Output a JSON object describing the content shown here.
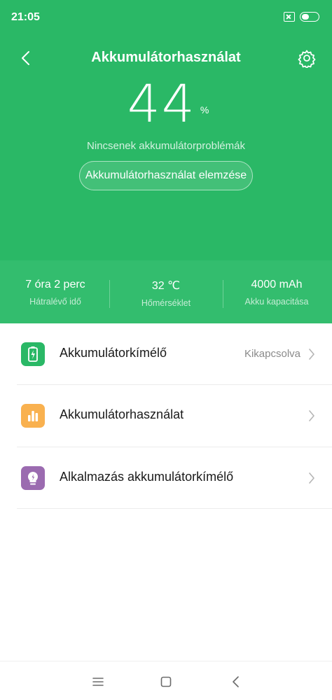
{
  "status_bar": {
    "time": "21:05",
    "battery_level": 0.44
  },
  "header": {
    "title": "Akkumulátorhasználat",
    "back_icon": "chevron-left-icon",
    "settings_icon": "gear-icon"
  },
  "battery": {
    "percent": "44",
    "unit": "%",
    "status": "Nincsenek akkumulátorproblémák",
    "analyze_label": "Akkumulátorhasználat elemzése"
  },
  "stats": [
    {
      "value": "7 óra 2 perc",
      "label": "Hátralévő idő"
    },
    {
      "value": "32 ℃",
      "label": "Hőmérséklet"
    },
    {
      "value": "4000 mAh",
      "label": "Akku kapacitása"
    }
  ],
  "menu": [
    {
      "label": "Akkumulátorkímélő",
      "value": "Kikapcsolva",
      "icon": "battery-saver-icon",
      "color": "#2ab866"
    },
    {
      "label": "Akkumulátorhasználat",
      "value": "",
      "icon": "bar-chart-icon",
      "color": "#f9b14f"
    },
    {
      "label": "Alkalmazás akkumulátorkímélő",
      "value": "",
      "icon": "lightbulb-icon",
      "color": "#9b6bb0"
    }
  ],
  "colors": {
    "accent": "#2ab866"
  },
  "nav": {
    "menu_icon": "menu-icon",
    "home_icon": "home-icon",
    "back_icon": "back-icon"
  }
}
